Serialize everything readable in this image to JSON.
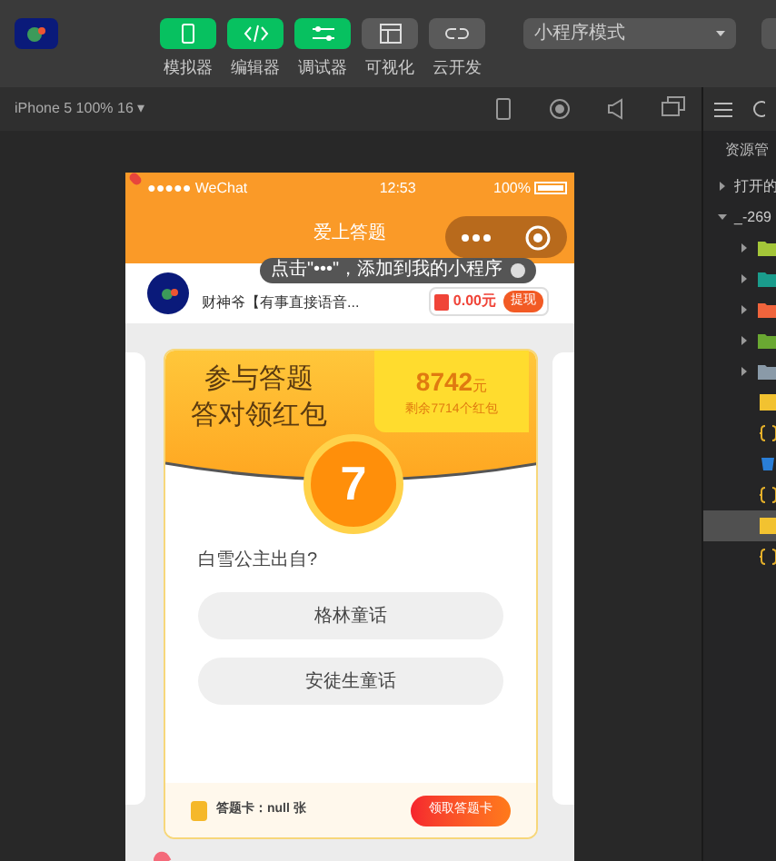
{
  "toolbar": {
    "buttons": [
      {
        "label": "模拟器",
        "kind": "phone",
        "on": true
      },
      {
        "label": "编辑器",
        "kind": "code",
        "on": true
      },
      {
        "label": "调试器",
        "kind": "sliders",
        "on": true
      },
      {
        "label": "可视化",
        "kind": "layout",
        "on": false
      },
      {
        "label": "云开发",
        "kind": "cloud",
        "on": false
      }
    ],
    "mode": "小程序模式"
  },
  "device_bar": {
    "device": "iPhone 5 100% 16 ▾"
  },
  "phone": {
    "status": {
      "carrier": "●●●●● WeChat",
      "time": "12:53",
      "battery": "100%"
    },
    "nav_title": "爱上答题",
    "user": {
      "name": "财神爷【有事直接语音...",
      "balance": "0.00元",
      "withdraw": "提现"
    },
    "tooltip": "点击\"•••\"，添加到我的小程序",
    "card": {
      "headline": [
        "参与答题",
        "答对领红包"
      ],
      "prize": "8742",
      "prize_unit": "元",
      "remaining": "剩余7714个红包",
      "countdown": "7",
      "question": "白雪公主出自?",
      "options": [
        {
          "label": "格林童话"
        },
        {
          "label": "安徒生童话"
        }
      ],
      "card_count": "答题卡：null 张",
      "claim": "领取答题卡"
    }
  },
  "explorer": {
    "title": "资源管",
    "tree": [
      {
        "label": "打开的",
        "expanded": false
      },
      {
        "label": "_-269",
        "expanded": true,
        "children": [
          {
            "kind": "folder",
            "color": "#a4c639",
            "selected": false
          },
          {
            "kind": "folder",
            "color": "#1a9c8c",
            "selected": false
          },
          {
            "kind": "folder",
            "color": "#f0643c",
            "selected": false
          },
          {
            "kind": "folder",
            "color": "#6aa832",
            "selected": false
          },
          {
            "kind": "folder",
            "color": "#8a9aa8",
            "selected": false
          },
          {
            "kind": "js",
            "selected": false
          },
          {
            "kind": "json",
            "selected": false
          },
          {
            "kind": "css",
            "selected": false
          },
          {
            "kind": "json",
            "selected": false
          },
          {
            "kind": "js",
            "selected": true
          },
          {
            "kind": "json",
            "selected": false
          }
        ]
      }
    ]
  }
}
